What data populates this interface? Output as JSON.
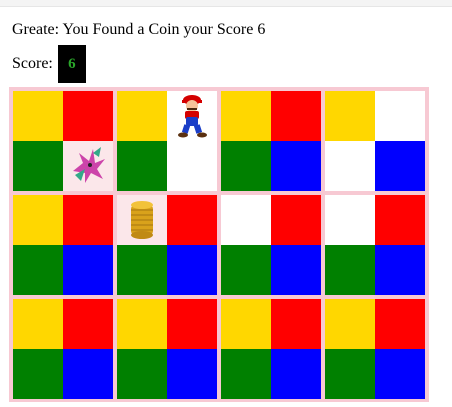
{
  "status": {
    "message": "Greate: You Found a Coin your Score 6",
    "score_label": "Score:",
    "score_value": "6"
  },
  "board": {
    "tiles": [
      {
        "row": 0,
        "col": 0,
        "cells": [
          {
            "color": "yellow"
          },
          {
            "color": "red"
          },
          {
            "color": "green"
          },
          {
            "color": "pinkish",
            "sprite": "dragon-icon"
          }
        ]
      },
      {
        "row": 0,
        "col": 1,
        "cells": [
          {
            "color": "yellow"
          },
          {
            "color": "white",
            "sprite": "mario-icon"
          },
          {
            "color": "green"
          },
          {
            "color": "white"
          }
        ]
      },
      {
        "row": 0,
        "col": 2,
        "cells": [
          {
            "color": "yellow"
          },
          {
            "color": "red"
          },
          {
            "color": "green"
          },
          {
            "color": "blue"
          }
        ]
      },
      {
        "row": 0,
        "col": 3,
        "cells": [
          {
            "color": "yellow"
          },
          {
            "color": "white"
          },
          {
            "color": "white"
          },
          {
            "color": "blue"
          }
        ]
      },
      {
        "row": 1,
        "col": 0,
        "cells": [
          {
            "color": "yellow"
          },
          {
            "color": "red"
          },
          {
            "color": "green"
          },
          {
            "color": "blue"
          }
        ]
      },
      {
        "row": 1,
        "col": 1,
        "cells": [
          {
            "color": "pinkish",
            "sprite": "coin-stack-icon"
          },
          {
            "color": "red"
          },
          {
            "color": "green"
          },
          {
            "color": "blue"
          }
        ]
      },
      {
        "row": 1,
        "col": 2,
        "cells": [
          {
            "color": "white"
          },
          {
            "color": "red"
          },
          {
            "color": "green"
          },
          {
            "color": "blue"
          }
        ]
      },
      {
        "row": 1,
        "col": 3,
        "cells": [
          {
            "color": "white"
          },
          {
            "color": "red"
          },
          {
            "color": "green"
          },
          {
            "color": "blue"
          }
        ]
      },
      {
        "row": 2,
        "col": 0,
        "cells": [
          {
            "color": "yellow"
          },
          {
            "color": "red"
          },
          {
            "color": "green"
          },
          {
            "color": "blue"
          }
        ]
      },
      {
        "row": 2,
        "col": 1,
        "cells": [
          {
            "color": "yellow"
          },
          {
            "color": "red"
          },
          {
            "color": "green"
          },
          {
            "color": "blue"
          }
        ]
      },
      {
        "row": 2,
        "col": 2,
        "cells": [
          {
            "color": "yellow"
          },
          {
            "color": "red"
          },
          {
            "color": "green"
          },
          {
            "color": "blue"
          }
        ]
      },
      {
        "row": 2,
        "col": 3,
        "cells": [
          {
            "color": "yellow"
          },
          {
            "color": "red"
          },
          {
            "color": "green"
          },
          {
            "color": "blue"
          }
        ]
      }
    ]
  },
  "colors": {
    "yellow": "#ffd700",
    "red": "#ff0000",
    "green": "#008000",
    "blue": "#0000ff",
    "white": "#ffffff",
    "board_border": "#f7c9d3",
    "score_box": "#000000",
    "score_text": "#2aa52a"
  }
}
